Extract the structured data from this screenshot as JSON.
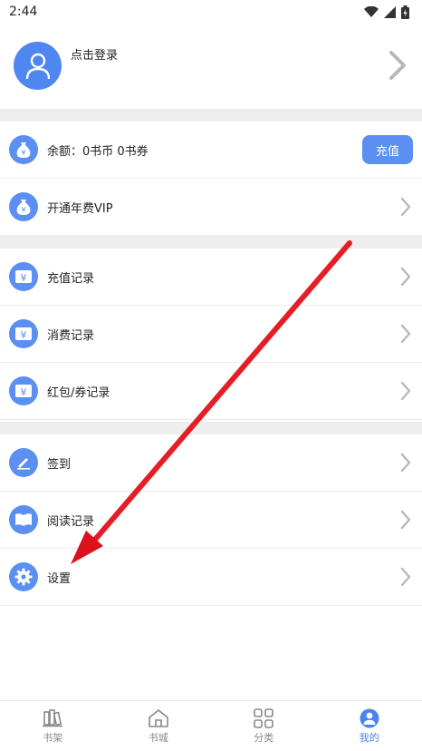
{
  "status": {
    "time": "2:44"
  },
  "profile": {
    "login_text": "点击登录"
  },
  "account": {
    "balance_label": "余额：0书币  0书券",
    "recharge_button": "充值",
    "vip_label": "开通年费VIP"
  },
  "records": [
    {
      "label": "充值记录"
    },
    {
      "label": "消费记录"
    },
    {
      "label": "红包/券记录"
    }
  ],
  "misc": [
    {
      "label": "签到"
    },
    {
      "label": "阅读记录"
    },
    {
      "label": "设置"
    }
  ],
  "tabs": [
    {
      "label": "书架",
      "icon": "bookshelf-icon"
    },
    {
      "label": "书城",
      "icon": "home-icon"
    },
    {
      "label": "分类",
      "icon": "category-icon"
    },
    {
      "label": "我的",
      "icon": "profile-icon"
    }
  ],
  "colors": {
    "accent": "#5b8ff1",
    "active_tab": "#4a84f0",
    "annotation_arrow": "#e8202a"
  }
}
